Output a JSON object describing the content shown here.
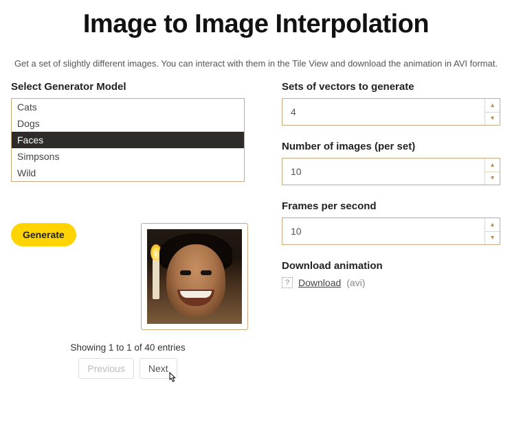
{
  "title": "Image to Image Interpolation",
  "subtitle": "Get a set of slightly different images. You can interact with them in the Tile View and download the animation in AVI format.",
  "left": {
    "generator_label": "Select Generator Model",
    "generator_options": [
      "Cats",
      "Dogs",
      "Faces",
      "Simpsons",
      "Wild"
    ],
    "generator_selected_index": 2,
    "generate_button": "Generate",
    "entries_info": "Showing 1 to 1 of 40 entries",
    "pager": {
      "previous": "Previous",
      "next": "Next"
    }
  },
  "right": {
    "sets": {
      "label": "Sets of vectors to generate",
      "value": "4"
    },
    "images": {
      "label": "Number of images (per set)",
      "value": "10"
    },
    "fps": {
      "label": "Frames per second",
      "value": "10"
    },
    "download": {
      "label": "Download animation",
      "link_text": "Download",
      "ext": "(avi)",
      "icon_char": "?"
    }
  }
}
